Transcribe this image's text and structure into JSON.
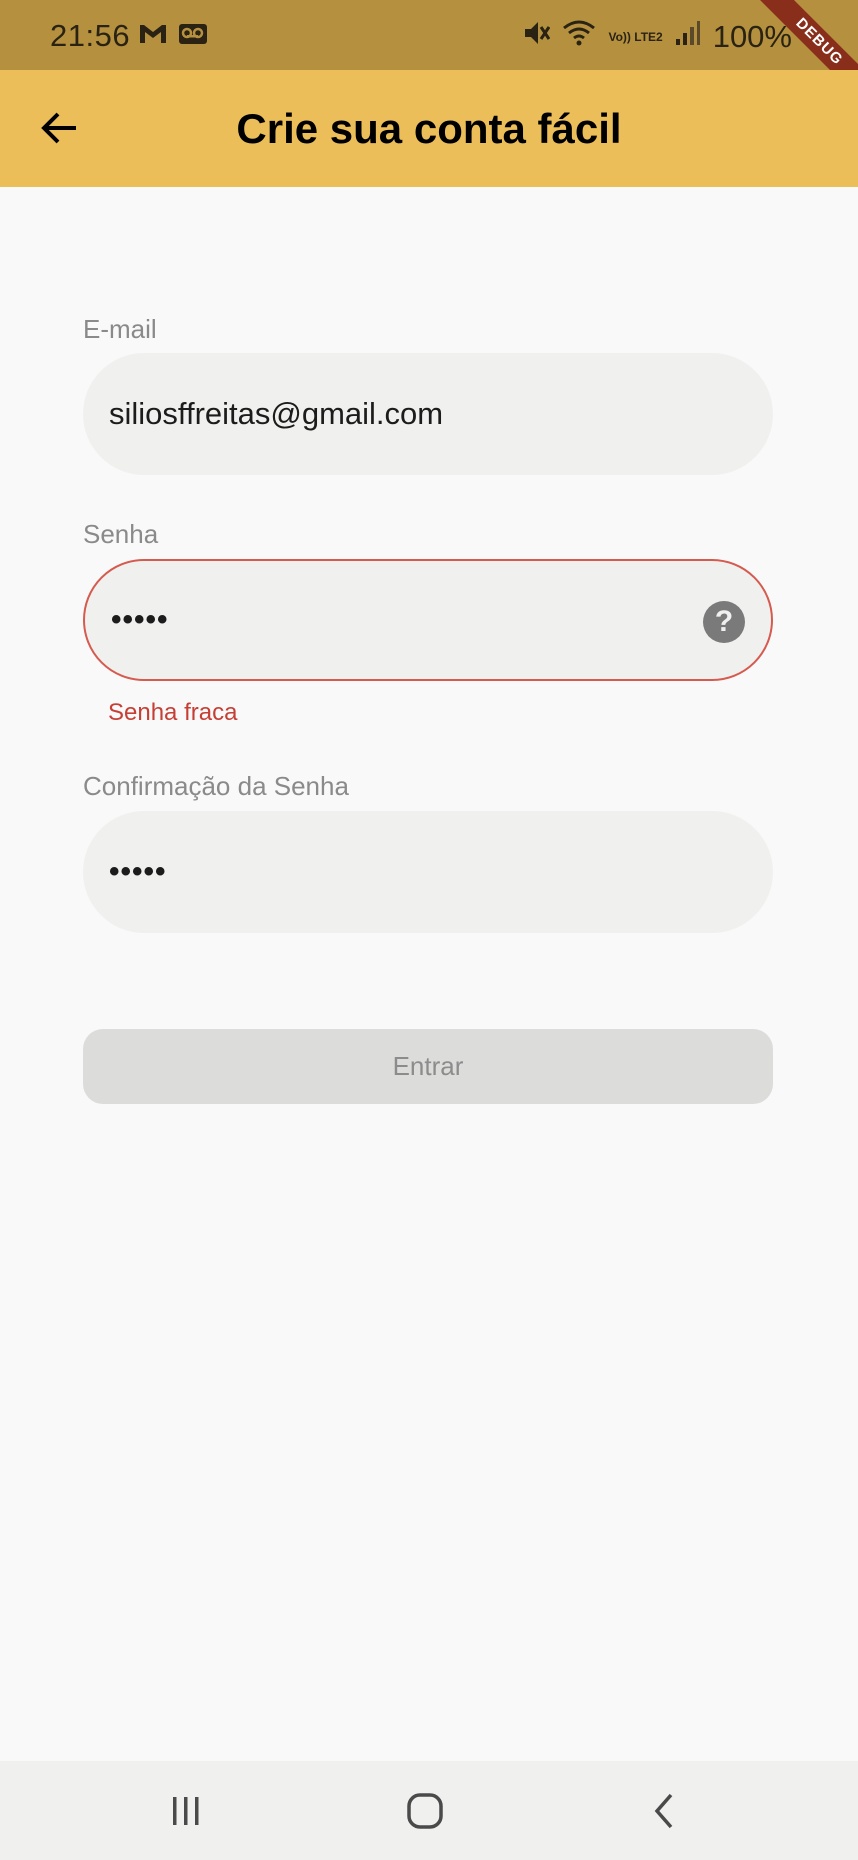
{
  "status_bar": {
    "time": "21:56",
    "battery": "100%",
    "network_label": "Vo)) LTE2",
    "icons": [
      "gmail-icon",
      "voicemail-icon",
      "mute-icon",
      "wifi-icon",
      "signal-icon",
      "battery-icon"
    ]
  },
  "debug_banner": "DEBUG",
  "app_bar": {
    "title": "Crie sua conta fácil",
    "back_icon": "arrow-left-icon"
  },
  "form": {
    "email": {
      "label": "E-mail",
      "value": "siliosffreitas@gmail.com"
    },
    "password": {
      "label": "Senha",
      "value": "•••••",
      "error": "Senha fraca",
      "help_icon": "help-circle-icon"
    },
    "confirm_password": {
      "label": "Confirmação da Senha",
      "value": "•••••"
    },
    "submit_label": "Entrar"
  },
  "nav_bar": {
    "buttons": [
      "recent-apps-icon",
      "home-icon",
      "back-icon"
    ]
  },
  "colors": {
    "app_bar": "#ebbe59",
    "status_bar": "#b5913f",
    "error": "#c53f36",
    "background": "#f8f9f8"
  }
}
